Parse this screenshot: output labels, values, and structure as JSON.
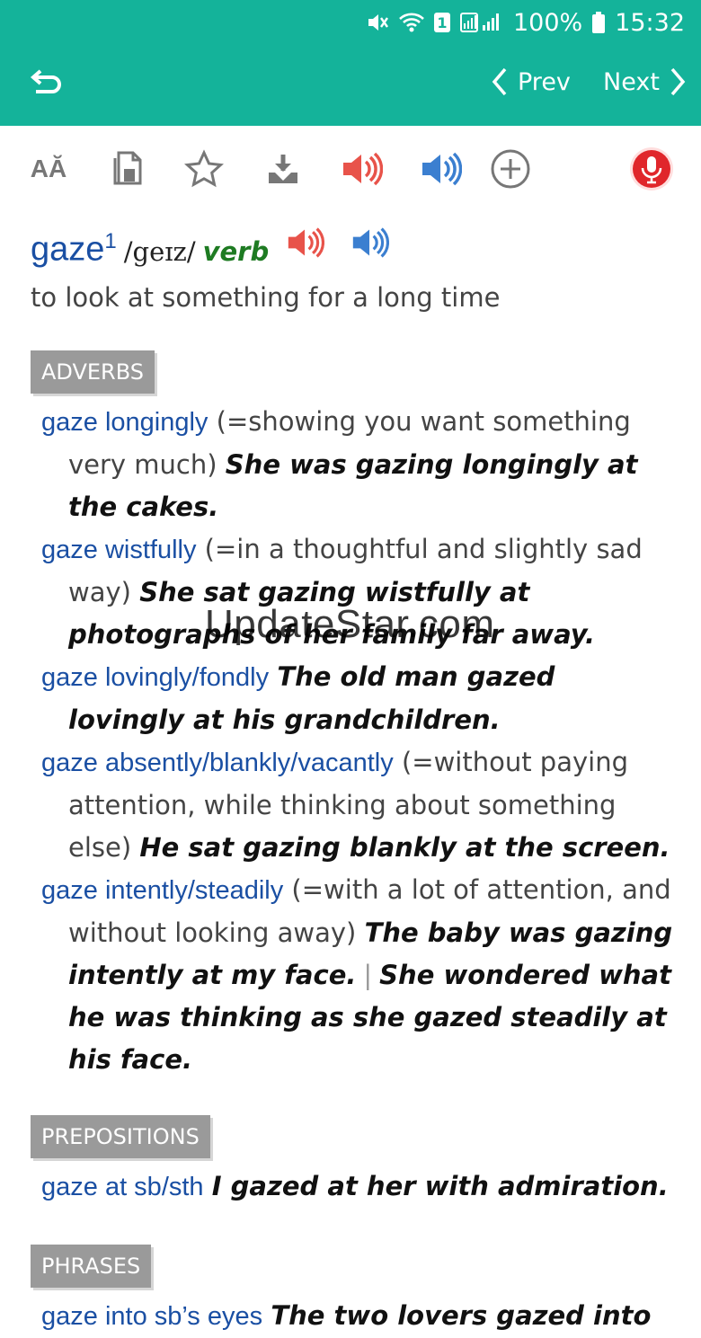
{
  "status_bar": {
    "battery": "100%",
    "time": "15:32",
    "sim_badge": "1"
  },
  "nav": {
    "prev_label": "Prev",
    "next_label": "Next"
  },
  "toolbar": {
    "icons": [
      "font-size-icon",
      "copy-icon",
      "star-icon",
      "download-icon",
      "speaker-red-icon",
      "speaker-blue-icon",
      "add-icon",
      "microphone-icon"
    ],
    "font_icon_text": "AĂ"
  },
  "entry": {
    "headword": "gaze",
    "superscript": "1",
    "pronunciation": "/geɪz/",
    "part_of_speech": "verb",
    "definition": "to look at something for a long time"
  },
  "sections": {
    "adverbs_label": "ADVERBS",
    "adverbs": [
      {
        "collocation": "gaze longingly",
        "gloss": " (=showing you want something very much) ",
        "example": "She was gazing longingly at the cakes."
      },
      {
        "collocation": "gaze wistfully",
        "gloss": " (=in a thoughtful and slightly sad way) ",
        "example": "She sat gazing wistfully at photographs of her family far away."
      },
      {
        "collocation": "gaze lovingly/fondly",
        "gloss": " ",
        "example": "The old man gazed lovingly at his grandchildren."
      },
      {
        "collocation": "gaze absently/blankly/vacantly",
        "gloss": " (=without paying attention, while thinking about something else) ",
        "example": "He sat gazing blankly at the screen."
      },
      {
        "collocation": "gaze intently/steadily",
        "gloss": " (=with a lot of attention, and without looking away) ",
        "example": "The baby was gazing intently at my face.",
        "separator": "|",
        "example2": "She wondered what he was thinking as she gazed steadily at his face."
      }
    ],
    "prepositions_label": "PREPOSITIONS",
    "prepositions": [
      {
        "collocation": "gaze at sb/sth",
        "example": "I gazed at her with admiration."
      }
    ],
    "phrases_label": "PHRASES",
    "phrases": [
      {
        "collocation": "gaze into sb’s eyes",
        "example": "The two lovers gazed into"
      }
    ]
  },
  "watermark": "UpdateStar.com",
  "colors": {
    "header": "#14b39a",
    "link_blue": "#1a4fa3",
    "pos_green": "#1e7b22",
    "speaker_red": "#e8534a",
    "speaker_blue": "#3b7fd0",
    "section_gray": "#9a9a9a"
  }
}
